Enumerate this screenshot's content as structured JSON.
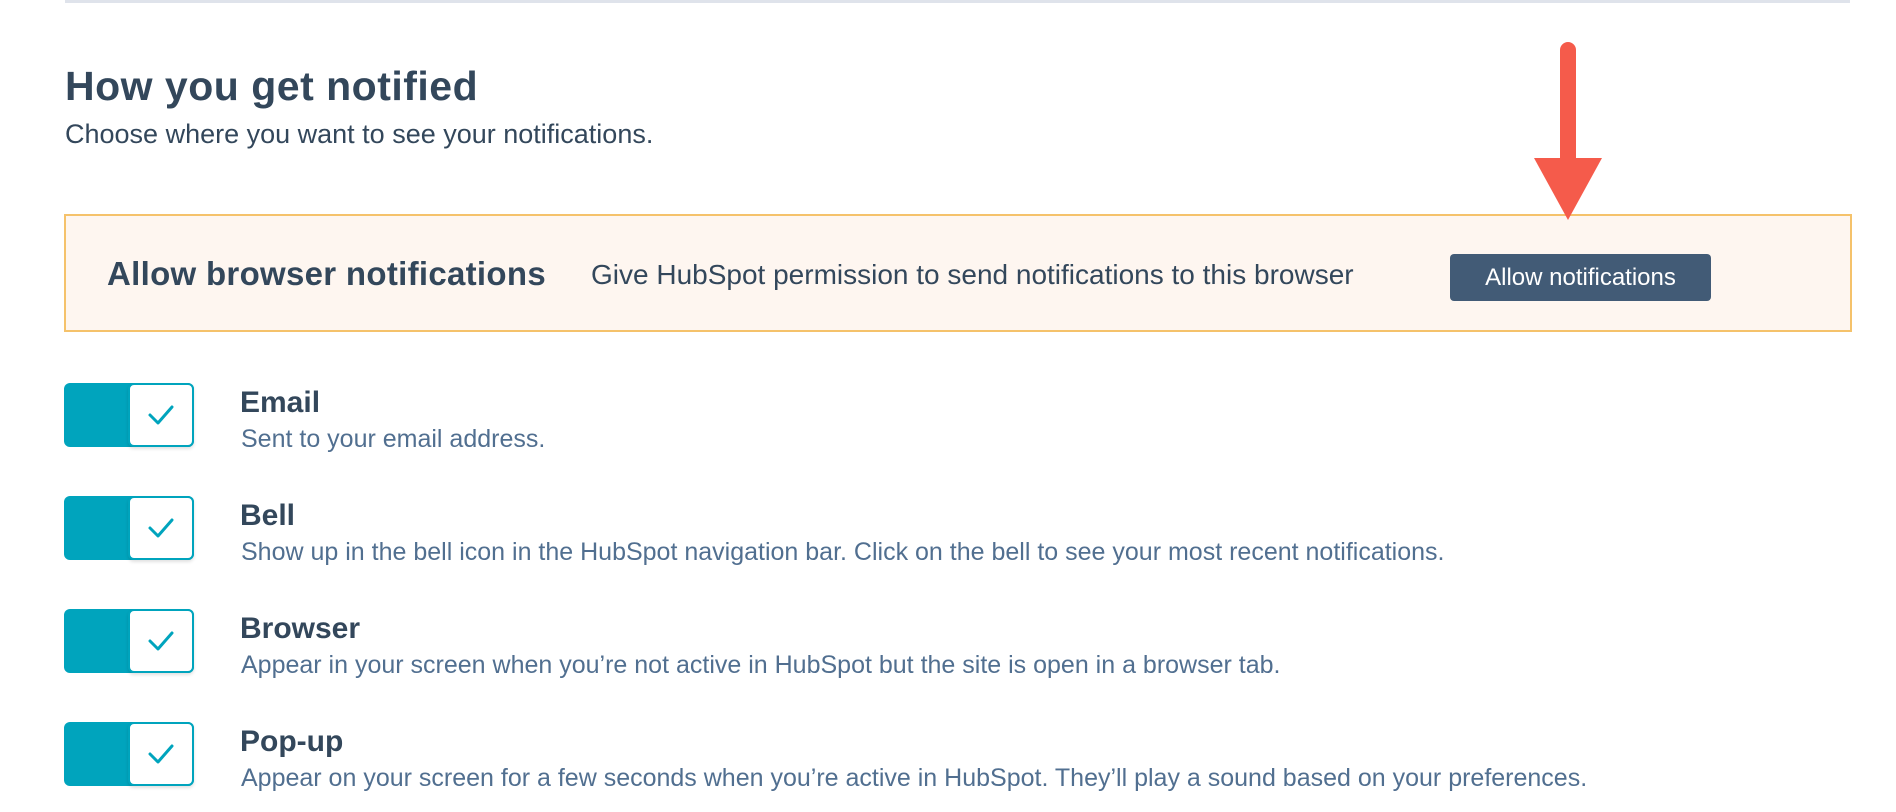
{
  "section": {
    "title": "How you get notified",
    "subtitle": "Choose where you want to see your notifications."
  },
  "banner": {
    "title": "Allow browser notifications",
    "description": "Give HubSpot permission to send notifications to this browser",
    "button_label": "Allow notifications"
  },
  "annotation": {
    "arrow_color": "#f55b4b",
    "icon": "arrow-down-icon"
  },
  "colors": {
    "toggle_on": "#00a4bd",
    "button_bg": "#425b76",
    "banner_bg": "#fef6f0",
    "banner_border": "#f5c26b",
    "heading_text": "#33475b"
  },
  "channels": [
    {
      "label": "Email",
      "description": "Sent to your email address.",
      "enabled": true
    },
    {
      "label": "Bell",
      "description": "Show up in the bell icon in the HubSpot navigation bar. Click on the bell to see your most recent notifications.",
      "enabled": true
    },
    {
      "label": "Browser",
      "description": "Appear in your screen when you’re not active in HubSpot but the site is open in a browser tab.",
      "enabled": true
    },
    {
      "label": "Pop-up",
      "description": "Appear on your screen for a few seconds when you’re active in HubSpot. They’ll play a sound based on your preferences.",
      "enabled": true
    }
  ]
}
